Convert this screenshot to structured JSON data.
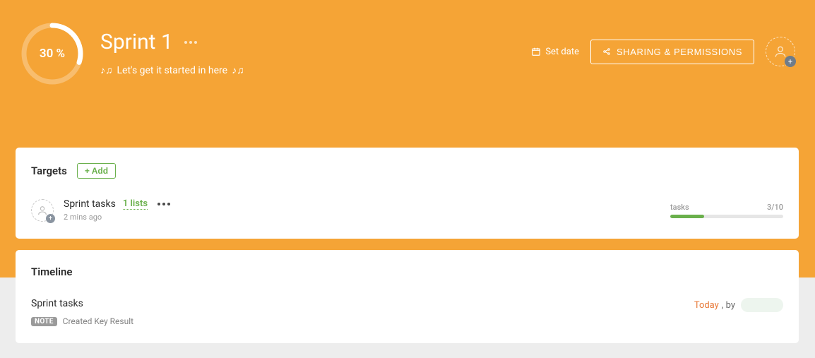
{
  "header": {
    "progress_pct": "30 %",
    "progress_value": 30,
    "title": "Sprint 1",
    "subtitle": "Let's get it started in here",
    "set_date": "Set date",
    "share_label": "SHARING & PERMISSIONS"
  },
  "targets": {
    "title": "Targets",
    "add_label": "+ Add",
    "items": [
      {
        "name": "Sprint tasks",
        "lists_label": "1 lists",
        "time": "2 mins ago",
        "progress_label": "tasks",
        "progress_text": "3/10",
        "progress_pct": 30
      }
    ]
  },
  "timeline": {
    "title": "Timeline",
    "items": [
      {
        "name": "Sprint tasks",
        "note_badge": "NOTE",
        "note_text": "Created Key Result",
        "date_label": "Today",
        "by_label": ", by"
      }
    ]
  }
}
